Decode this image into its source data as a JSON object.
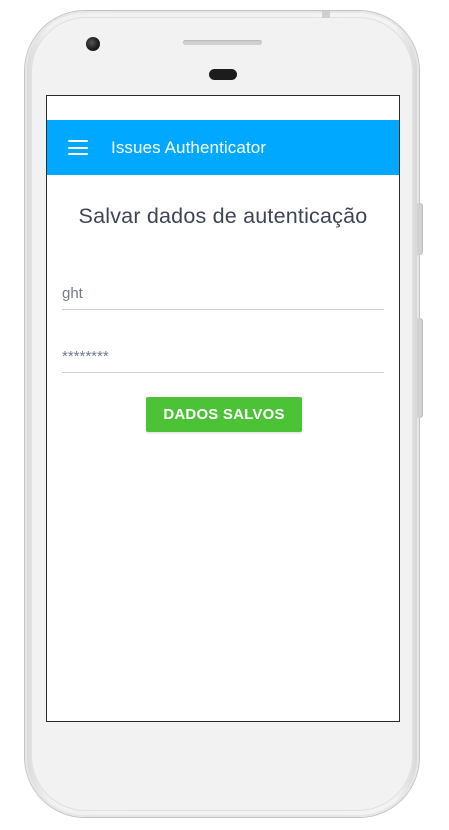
{
  "app_bar": {
    "title": "Issues Authenticator",
    "menu_icon": "hamburger-menu-icon",
    "background_color": "#00a8ff"
  },
  "page": {
    "title": "Salvar dados de autenticação"
  },
  "form": {
    "username_value": "ght",
    "password_value": "********",
    "save_button_label": "DADOS SALVOS",
    "save_button_color": "#4cc237"
  }
}
